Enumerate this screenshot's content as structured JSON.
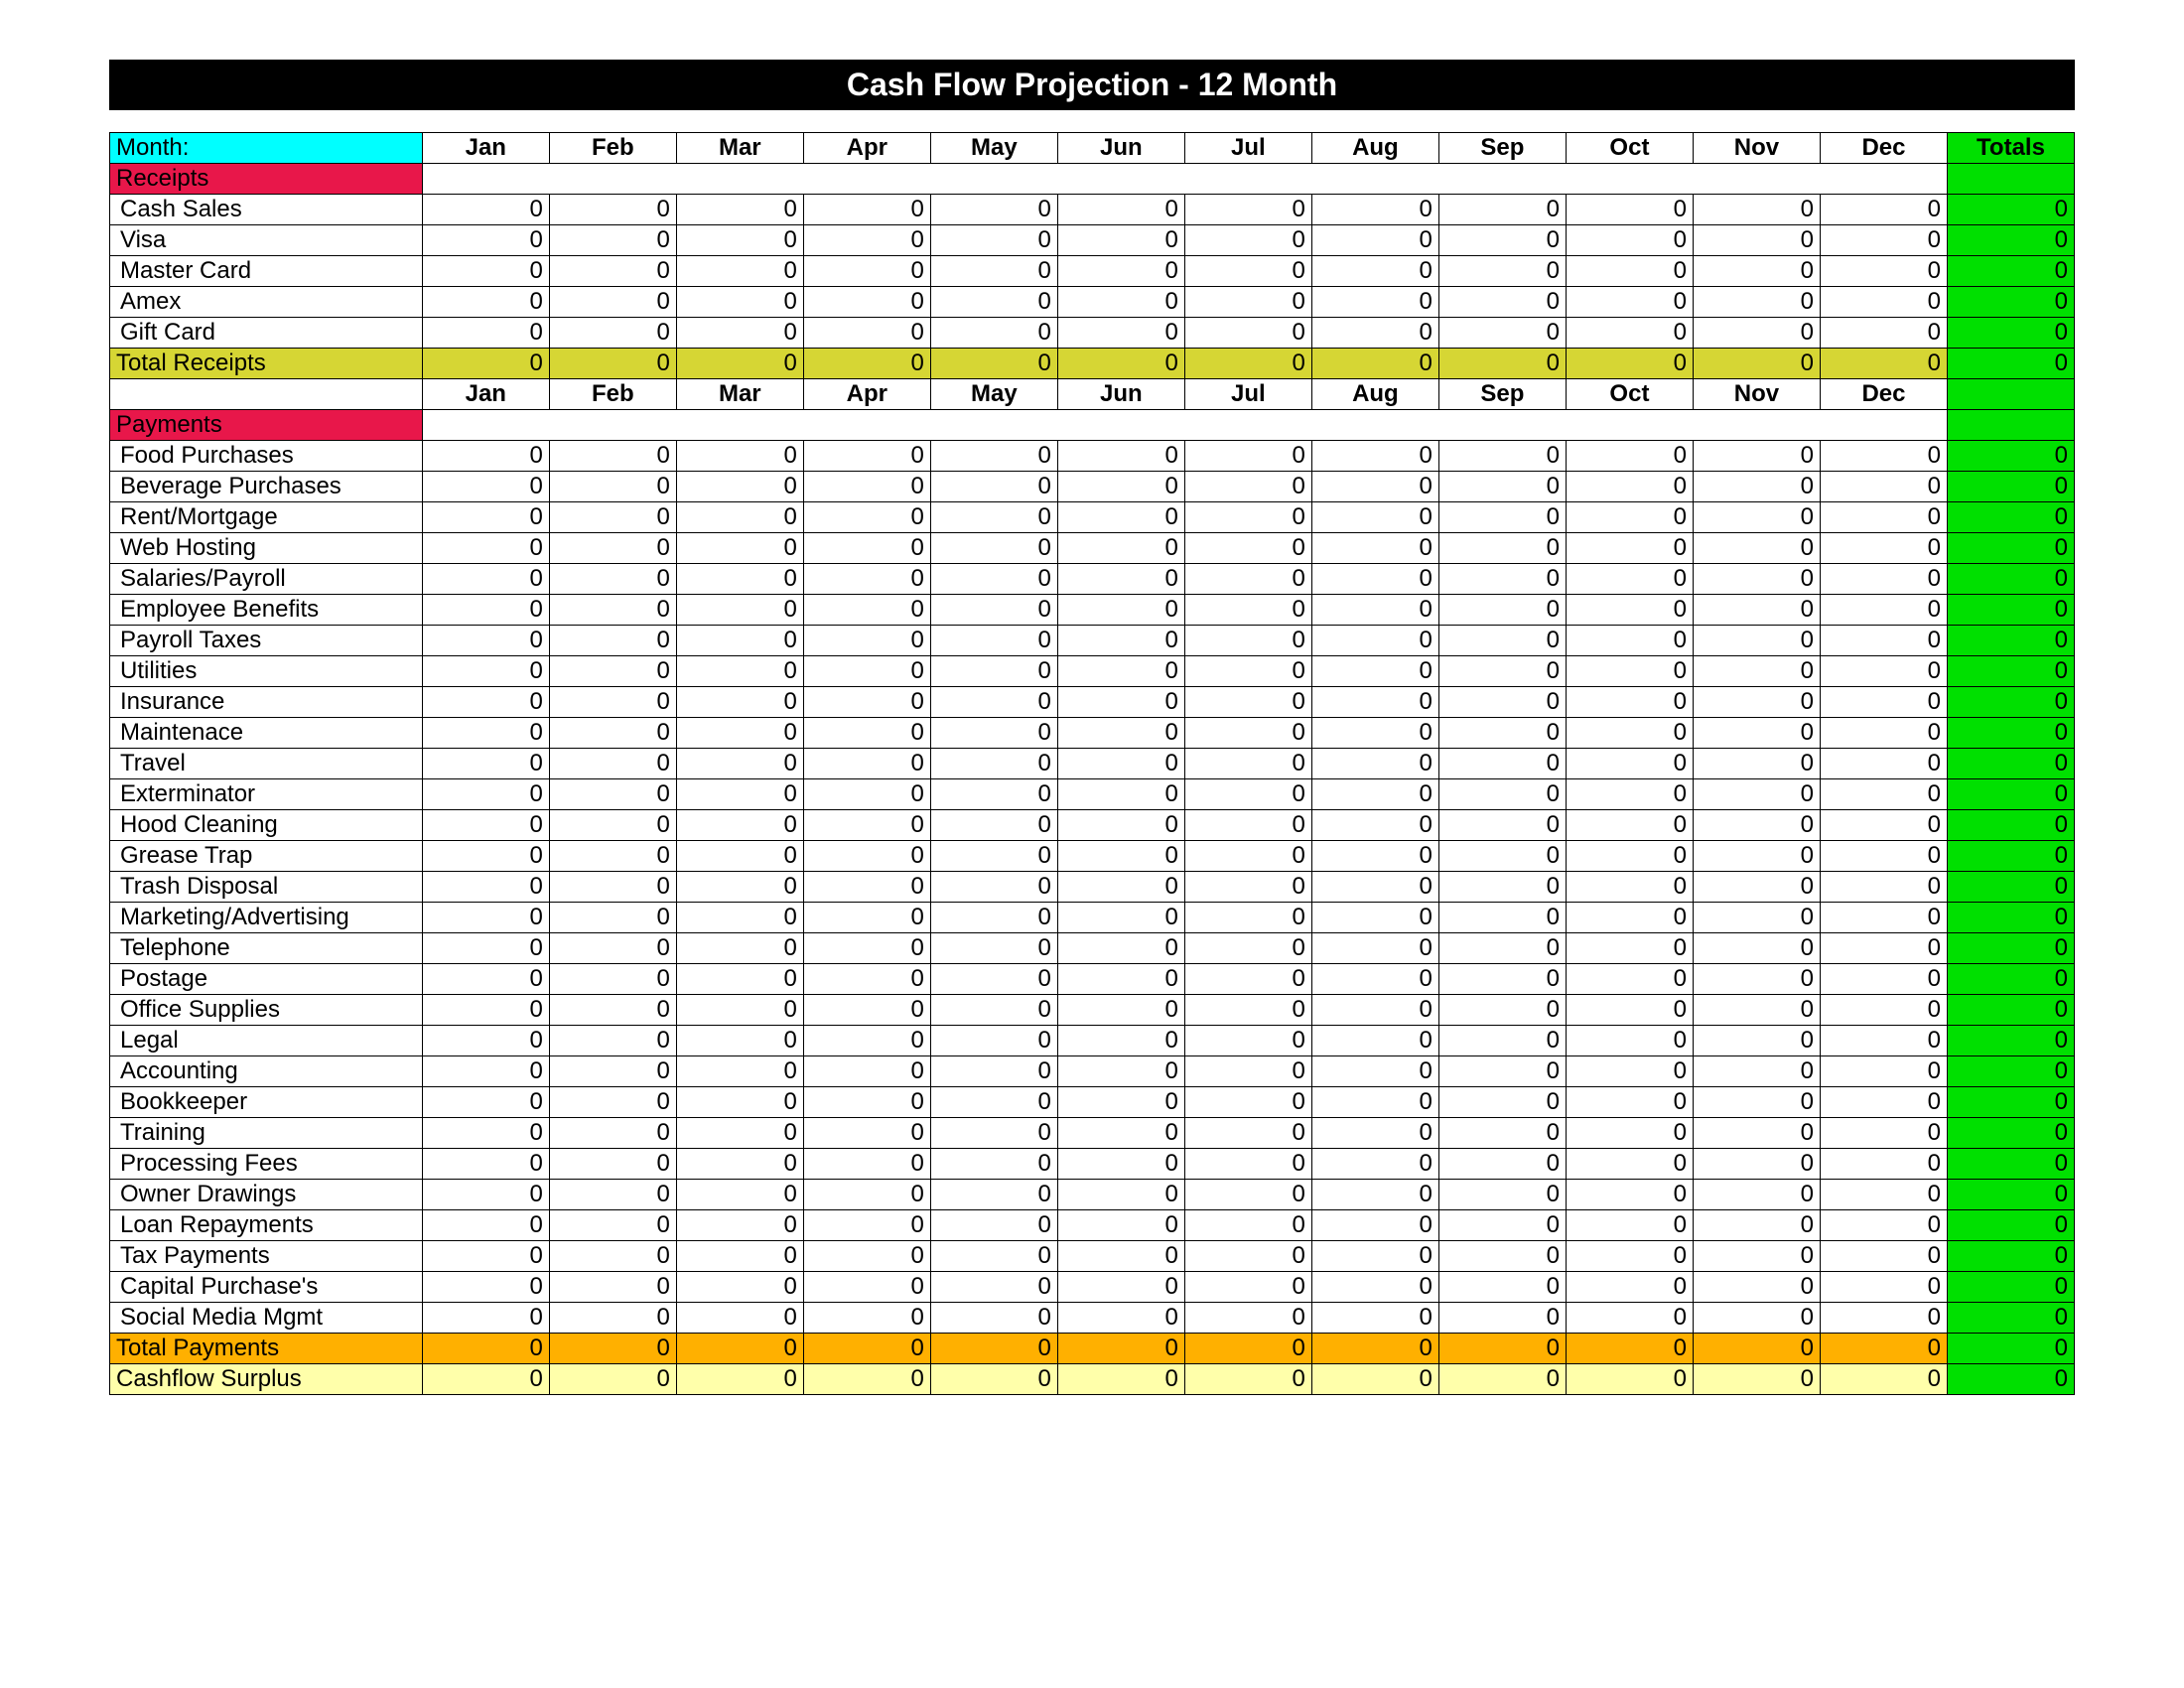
{
  "title": "Cash Flow Projection    -     12 Month",
  "monthLabel": "Month:",
  "months": [
    "Jan",
    "Feb",
    "Mar",
    "Apr",
    "May",
    "Jun",
    "Jul",
    "Aug",
    "Sep",
    "Oct",
    "Nov",
    "Dec"
  ],
  "totalsHeader": "Totals",
  "sections": {
    "receipts": {
      "header": "Receipts",
      "rows": [
        {
          "label": "Cash Sales",
          "values": [
            0,
            0,
            0,
            0,
            0,
            0,
            0,
            0,
            0,
            0,
            0,
            0
          ],
          "total": 0
        },
        {
          "label": "Visa",
          "values": [
            0,
            0,
            0,
            0,
            0,
            0,
            0,
            0,
            0,
            0,
            0,
            0
          ],
          "total": 0
        },
        {
          "label": "Master Card",
          "values": [
            0,
            0,
            0,
            0,
            0,
            0,
            0,
            0,
            0,
            0,
            0,
            0
          ],
          "total": 0
        },
        {
          "label": "Amex",
          "values": [
            0,
            0,
            0,
            0,
            0,
            0,
            0,
            0,
            0,
            0,
            0,
            0
          ],
          "total": 0
        },
        {
          "label": "Gift Card",
          "values": [
            0,
            0,
            0,
            0,
            0,
            0,
            0,
            0,
            0,
            0,
            0,
            0
          ],
          "total": 0
        }
      ],
      "totalRow": {
        "label": "Total Receipts",
        "values": [
          0,
          0,
          0,
          0,
          0,
          0,
          0,
          0,
          0,
          0,
          0,
          0
        ],
        "total": 0
      }
    },
    "payments": {
      "header": "Payments",
      "rows": [
        {
          "label": "Food Purchases",
          "values": [
            0,
            0,
            0,
            0,
            0,
            0,
            0,
            0,
            0,
            0,
            0,
            0
          ],
          "total": 0
        },
        {
          "label": "Beverage Purchases",
          "values": [
            0,
            0,
            0,
            0,
            0,
            0,
            0,
            0,
            0,
            0,
            0,
            0
          ],
          "total": 0
        },
        {
          "label": "Rent/Mortgage",
          "values": [
            0,
            0,
            0,
            0,
            0,
            0,
            0,
            0,
            0,
            0,
            0,
            0
          ],
          "total": 0
        },
        {
          "label": "Web Hosting",
          "values": [
            0,
            0,
            0,
            0,
            0,
            0,
            0,
            0,
            0,
            0,
            0,
            0
          ],
          "total": 0
        },
        {
          "label": "Salaries/Payroll",
          "values": [
            0,
            0,
            0,
            0,
            0,
            0,
            0,
            0,
            0,
            0,
            0,
            0
          ],
          "total": 0
        },
        {
          "label": "Employee Benefits",
          "values": [
            0,
            0,
            0,
            0,
            0,
            0,
            0,
            0,
            0,
            0,
            0,
            0
          ],
          "total": 0
        },
        {
          "label": "Payroll Taxes",
          "values": [
            0,
            0,
            0,
            0,
            0,
            0,
            0,
            0,
            0,
            0,
            0,
            0
          ],
          "total": 0
        },
        {
          "label": "Utilities",
          "values": [
            0,
            0,
            0,
            0,
            0,
            0,
            0,
            0,
            0,
            0,
            0,
            0
          ],
          "total": 0
        },
        {
          "label": "Insurance",
          "values": [
            0,
            0,
            0,
            0,
            0,
            0,
            0,
            0,
            0,
            0,
            0,
            0
          ],
          "total": 0
        },
        {
          "label": "Maintenace",
          "values": [
            0,
            0,
            0,
            0,
            0,
            0,
            0,
            0,
            0,
            0,
            0,
            0
          ],
          "total": 0
        },
        {
          "label": "Travel",
          "values": [
            0,
            0,
            0,
            0,
            0,
            0,
            0,
            0,
            0,
            0,
            0,
            0
          ],
          "total": 0
        },
        {
          "label": "Exterminator",
          "values": [
            0,
            0,
            0,
            0,
            0,
            0,
            0,
            0,
            0,
            0,
            0,
            0
          ],
          "total": 0
        },
        {
          "label": "Hood Cleaning",
          "values": [
            0,
            0,
            0,
            0,
            0,
            0,
            0,
            0,
            0,
            0,
            0,
            0
          ],
          "total": 0
        },
        {
          "label": "Grease Trap",
          "values": [
            0,
            0,
            0,
            0,
            0,
            0,
            0,
            0,
            0,
            0,
            0,
            0
          ],
          "total": 0
        },
        {
          "label": "Trash Disposal",
          "values": [
            0,
            0,
            0,
            0,
            0,
            0,
            0,
            0,
            0,
            0,
            0,
            0
          ],
          "total": 0
        },
        {
          "label": "Marketing/Advertising",
          "values": [
            0,
            0,
            0,
            0,
            0,
            0,
            0,
            0,
            0,
            0,
            0,
            0
          ],
          "total": 0
        },
        {
          "label": "Telephone",
          "values": [
            0,
            0,
            0,
            0,
            0,
            0,
            0,
            0,
            0,
            0,
            0,
            0
          ],
          "total": 0
        },
        {
          "label": "Postage",
          "values": [
            0,
            0,
            0,
            0,
            0,
            0,
            0,
            0,
            0,
            0,
            0,
            0
          ],
          "total": 0
        },
        {
          "label": "Office Supplies",
          "values": [
            0,
            0,
            0,
            0,
            0,
            0,
            0,
            0,
            0,
            0,
            0,
            0
          ],
          "total": 0
        },
        {
          "label": "Legal",
          "values": [
            0,
            0,
            0,
            0,
            0,
            0,
            0,
            0,
            0,
            0,
            0,
            0
          ],
          "total": 0
        },
        {
          "label": "Accounting",
          "values": [
            0,
            0,
            0,
            0,
            0,
            0,
            0,
            0,
            0,
            0,
            0,
            0
          ],
          "total": 0
        },
        {
          "label": "Bookkeeper",
          "values": [
            0,
            0,
            0,
            0,
            0,
            0,
            0,
            0,
            0,
            0,
            0,
            0
          ],
          "total": 0
        },
        {
          "label": "Training",
          "values": [
            0,
            0,
            0,
            0,
            0,
            0,
            0,
            0,
            0,
            0,
            0,
            0
          ],
          "total": 0
        },
        {
          "label": "Processing Fees",
          "values": [
            0,
            0,
            0,
            0,
            0,
            0,
            0,
            0,
            0,
            0,
            0,
            0
          ],
          "total": 0
        },
        {
          "label": "Owner Drawings",
          "values": [
            0,
            0,
            0,
            0,
            0,
            0,
            0,
            0,
            0,
            0,
            0,
            0
          ],
          "total": 0
        },
        {
          "label": "Loan Repayments",
          "values": [
            0,
            0,
            0,
            0,
            0,
            0,
            0,
            0,
            0,
            0,
            0,
            0
          ],
          "total": 0
        },
        {
          "label": "Tax Payments",
          "values": [
            0,
            0,
            0,
            0,
            0,
            0,
            0,
            0,
            0,
            0,
            0,
            0
          ],
          "total": 0
        },
        {
          "label": "Capital Purchase's",
          "values": [
            0,
            0,
            0,
            0,
            0,
            0,
            0,
            0,
            0,
            0,
            0,
            0
          ],
          "total": 0
        },
        {
          "label": "Social Media Mgmt",
          "values": [
            0,
            0,
            0,
            0,
            0,
            0,
            0,
            0,
            0,
            0,
            0,
            0
          ],
          "total": 0
        }
      ],
      "totalRow": {
        "label": "Total Payments",
        "values": [
          0,
          0,
          0,
          0,
          0,
          0,
          0,
          0,
          0,
          0,
          0,
          0
        ],
        "total": 0
      }
    },
    "surplus": {
      "label": "Cashflow Surplus",
      "values": [
        0,
        0,
        0,
        0,
        0,
        0,
        0,
        0,
        0,
        0,
        0,
        0
      ],
      "total": 0
    }
  }
}
